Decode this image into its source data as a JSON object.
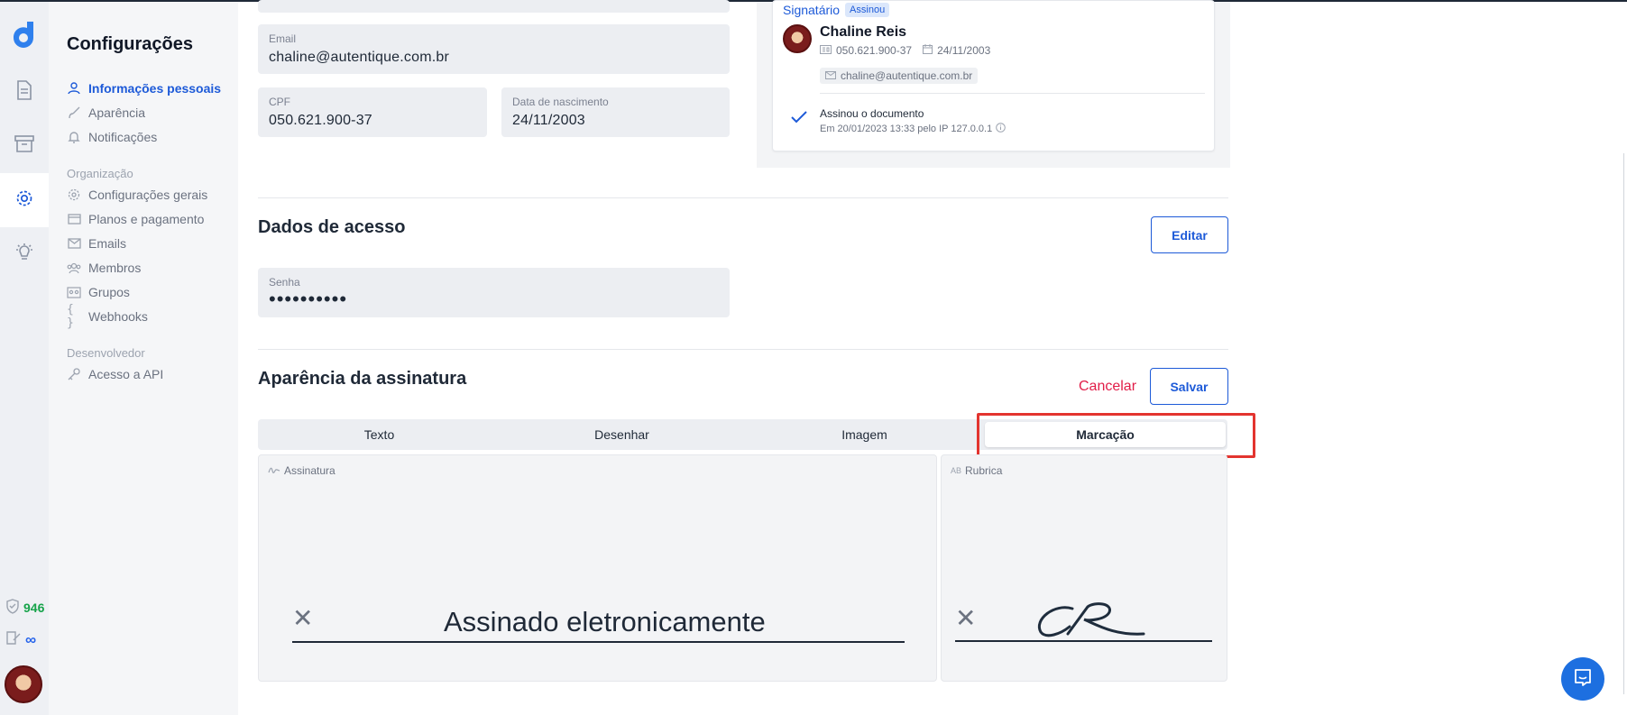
{
  "sidebar": {
    "title": "Configurações",
    "personal": [
      {
        "label": "Informações pessoais",
        "icon": "user-icon",
        "active": true
      },
      {
        "label": "Aparência",
        "icon": "brush-icon"
      },
      {
        "label": "Notificações",
        "icon": "bell-icon"
      }
    ],
    "org_group": "Organização",
    "org": [
      {
        "label": "Configurações gerais",
        "icon": "gear-icon"
      },
      {
        "label": "Planos e pagamento",
        "icon": "credit-card-icon"
      },
      {
        "label": "Emails",
        "icon": "mail-icon"
      },
      {
        "label": "Membros",
        "icon": "members-icon"
      },
      {
        "label": "Grupos",
        "icon": "groups-icon"
      },
      {
        "label": "Webhooks",
        "icon": "braces-icon"
      }
    ],
    "dev_group": "Desenvolvedor",
    "dev": [
      {
        "label": "Acesso a API",
        "icon": "key-icon"
      }
    ]
  },
  "rail": {
    "credits": "946",
    "documents_quota": "∞"
  },
  "personal": {
    "email_label": "Email",
    "email_value": "chaline@autentique.com.br",
    "cpf_label": "CPF",
    "cpf_value": "050.621.900-37",
    "birth_label": "Data de nascimento",
    "birth_value": "24/11/2003"
  },
  "signer_card": {
    "role": "Signatário",
    "status": "Assinou",
    "name": "Chaline Reis",
    "cpf": "050.621.900-37",
    "birth": "24/11/2003",
    "email": "chaline@autentique.com.br",
    "action": "Assinou o documento",
    "action_detail": "Em 20/01/2023 13:33 pelo IP 127.0.0.1"
  },
  "access": {
    "title": "Dados de acesso",
    "edit_label": "Editar",
    "password_label": "Senha",
    "password_value": "••••••••••"
  },
  "appearance": {
    "title": "Aparência da assinatura",
    "cancel_label": "Cancelar",
    "save_label": "Salvar",
    "tabs": [
      "Texto",
      "Desenhar",
      "Imagem",
      "Marcação"
    ],
    "active_tab": "Marcação",
    "signature_label": "Assinatura",
    "signature_text": "Assinado eletronicamente",
    "initials_label": "Rubrica"
  },
  "colors": {
    "accent": "#1d5ad8",
    "cancel": "#e11d48",
    "highlight": "#e3342f",
    "credits": "#16a34a"
  }
}
